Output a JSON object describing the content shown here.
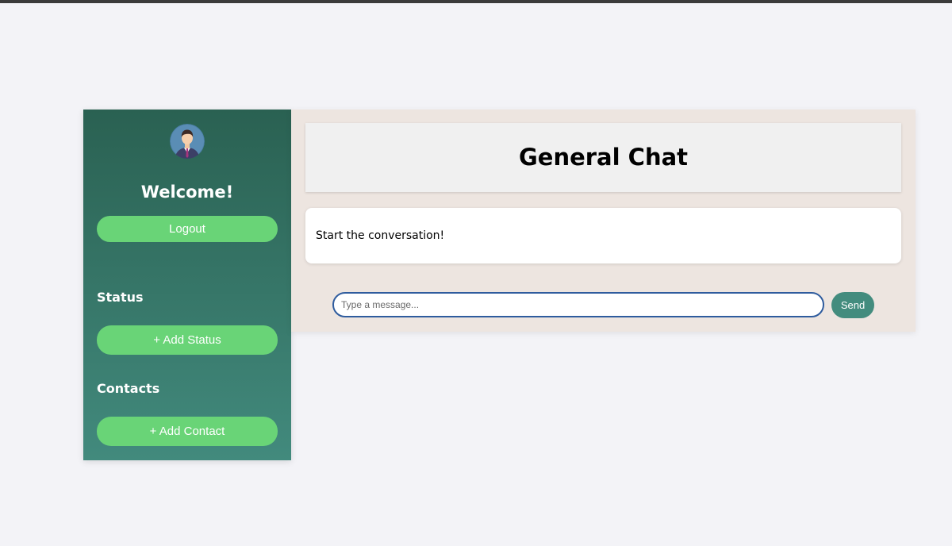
{
  "sidebar": {
    "avatar_icon": "user-avatar-icon",
    "welcome_text": "Welcome!",
    "logout_label": "Logout",
    "status_heading": "Status",
    "add_status_label": "+ Add Status",
    "contacts_heading": "Contacts",
    "add_contact_label": "+ Add Contact"
  },
  "chat": {
    "title": "General Chat",
    "empty_message": "Start the conversation!",
    "input_placeholder": "Type a message...",
    "input_value": "",
    "send_label": "Send"
  },
  "colors": {
    "sidebar_top": "#2a6152",
    "sidebar_bottom": "#428a7d",
    "button_green": "#69d477",
    "send_teal": "#438c7e",
    "input_border": "#2f5c9e",
    "chat_background": "#ede5e0",
    "page_background": "#f3f3f7"
  }
}
